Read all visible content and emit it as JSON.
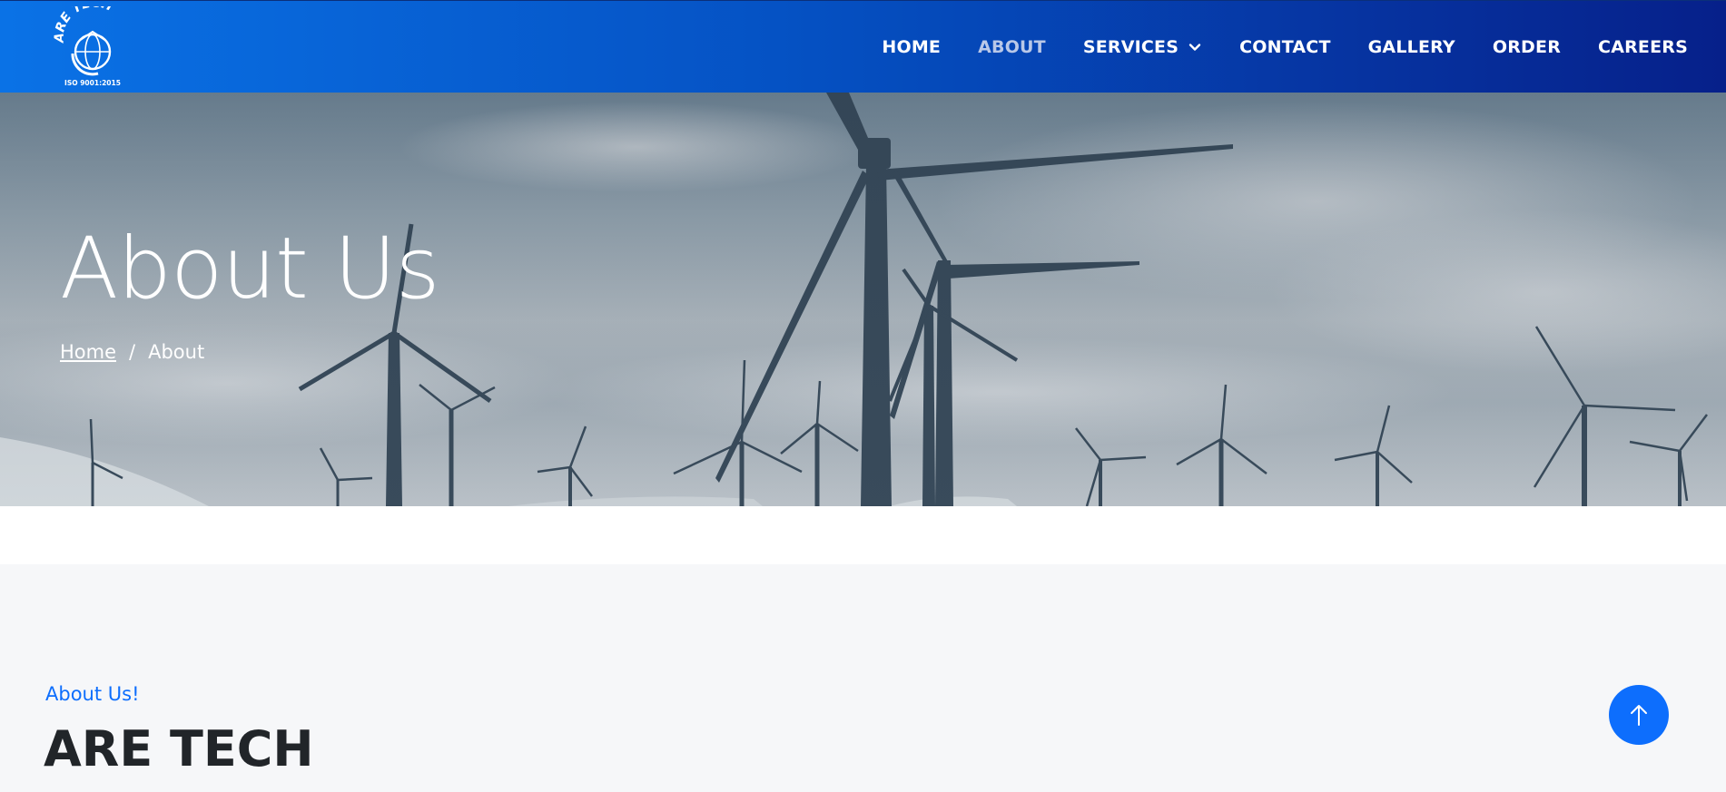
{
  "brand": {
    "name": "ARE TECH",
    "certification": "ISO 9001:2015",
    "logo_icon": "globe-logo-icon"
  },
  "nav": {
    "items": [
      {
        "label": "HOME",
        "active": false
      },
      {
        "label": "ABOUT",
        "active": true
      },
      {
        "label": "SERVICES",
        "active": false,
        "has_dropdown": true
      },
      {
        "label": "CONTACT",
        "active": false
      },
      {
        "label": "GALLERY",
        "active": false
      },
      {
        "label": "ORDER",
        "active": false
      },
      {
        "label": "CAREERS",
        "active": false
      }
    ]
  },
  "hero": {
    "title": "About Us",
    "breadcrumb": {
      "home": "Home",
      "separator": "/",
      "current": "About"
    }
  },
  "about": {
    "subtitle": "About Us!",
    "title": "ARE TECH"
  },
  "scroll_top": {
    "icon": "arrow-up-icon"
  },
  "colors": {
    "accent": "#0d6efd",
    "nav_start": "#0a72e6",
    "nav_end": "#06208a"
  }
}
